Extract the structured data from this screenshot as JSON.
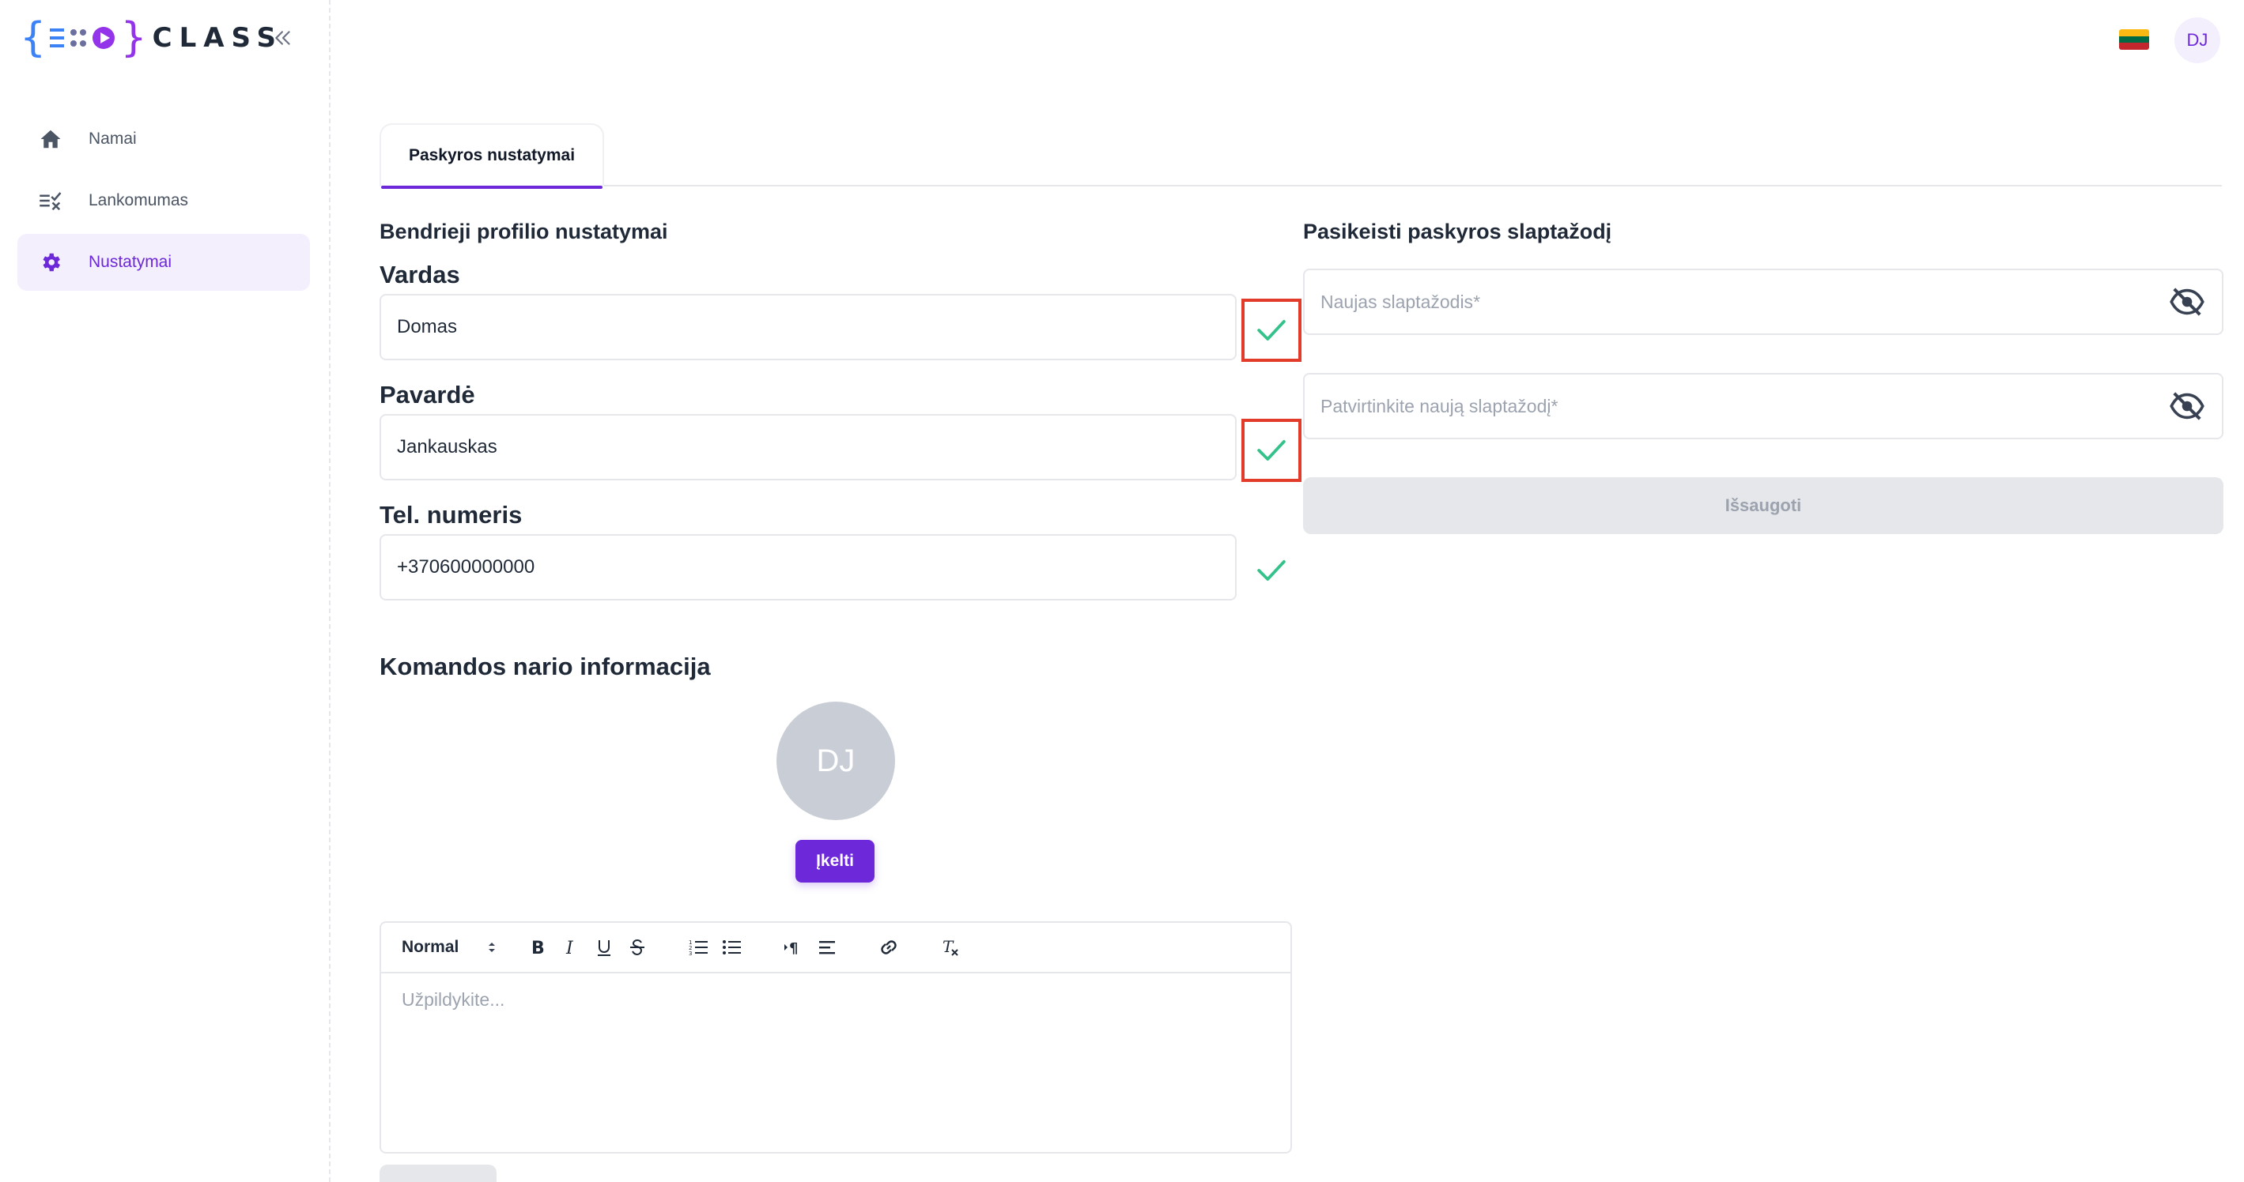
{
  "logo": {
    "left_brace": "{",
    "right_brace": "}",
    "name": "CLASS"
  },
  "sidebar": {
    "items": [
      {
        "label": "Namai",
        "icon": "home-icon"
      },
      {
        "label": "Lankomumas",
        "icon": "attendance-icon"
      },
      {
        "label": "Nustatymai",
        "icon": "gear-icon",
        "active": true
      }
    ]
  },
  "header": {
    "avatar_initials": "DJ",
    "language_flag": "lithuania-flag-icon"
  },
  "tabs": [
    {
      "label": "Paskyros nustatymai",
      "active": true
    }
  ],
  "profile": {
    "section_title": "Bendrieji profilio nustatymai",
    "first_name": {
      "label": "Vardas",
      "value": "Domas"
    },
    "last_name": {
      "label": "Pavardė",
      "value": "Jankauskas"
    },
    "phone": {
      "label": "Tel. numeris",
      "value": "+370600000000"
    }
  },
  "password": {
    "section_title": "Pasikeisti paskyros slaptažodį",
    "new_placeholder": "Naujas slaptažodis",
    "confirm_placeholder": "Patvirtinkite naują slaptažodį",
    "required_mark": "*",
    "save_label": "Išsaugoti"
  },
  "team": {
    "section_title": "Komandos nario informacija",
    "avatar_initials": "DJ",
    "upload_label": "Įkelti"
  },
  "editor": {
    "format_select": "Normal",
    "placeholder": "Užpildykite..."
  },
  "colors": {
    "accent": "#6d28d9",
    "accent_light": "#f3effc",
    "success": "#34c28a",
    "highlight": "#e23b2a"
  }
}
